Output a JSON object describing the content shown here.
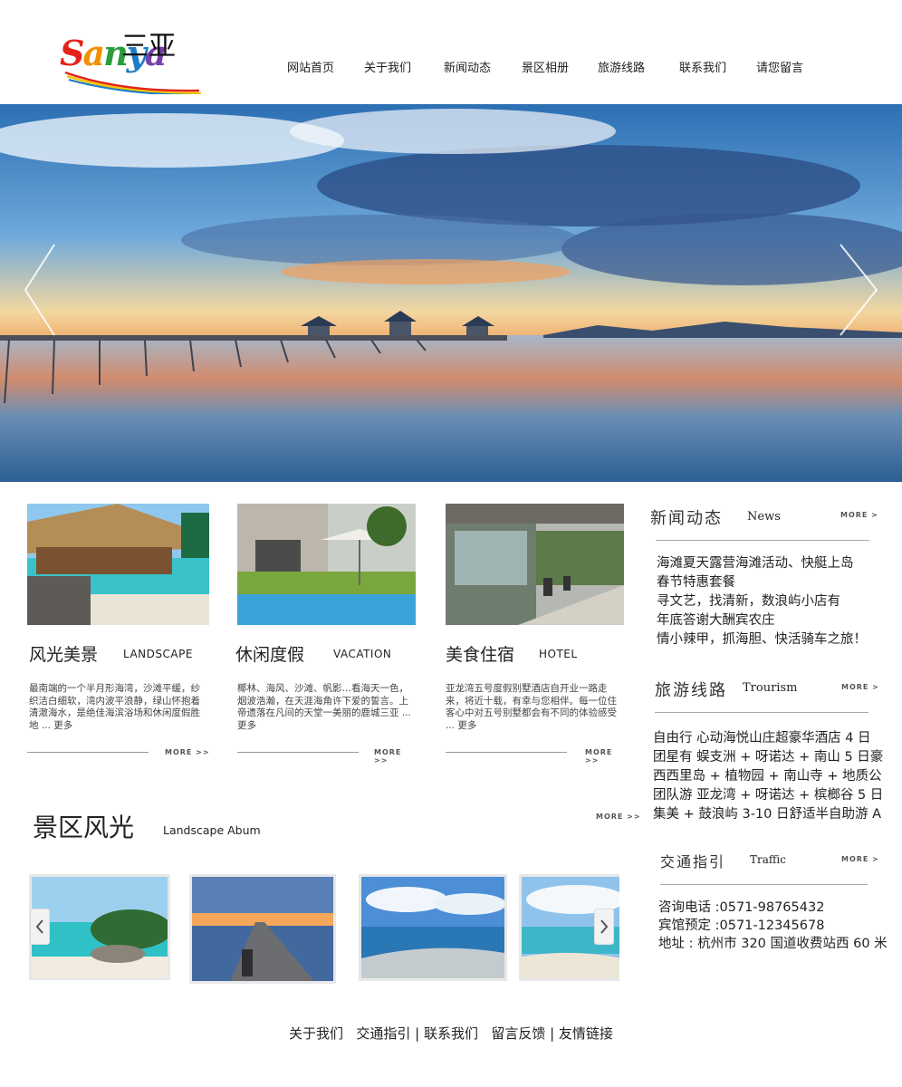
{
  "logo": {
    "latin": [
      "S",
      "a",
      "n",
      "y",
      "a"
    ],
    "hanzi": "三亚"
  },
  "nav": [
    "网站首页",
    "关于我们",
    "新闻动态",
    "景区相册",
    "旅游线路",
    "联系我们",
    "请您留言"
  ],
  "features": [
    {
      "title_cn": "风光美景",
      "title_en": "LANDSCAPE",
      "desc": "最南端的一个半月形海湾，沙滩平缓，纱织洁白细软，湾内波平浪静，绿山怀抱着清澈海水，是绝佳海滨浴场和休闲度假胜地 ... 更多",
      "more": "MORE >>"
    },
    {
      "title_cn": "休闲度假",
      "title_en": "VACATION",
      "desc": "椰林、海风、沙滩、帆影…看海天一色，烟波浩瀚，在天涯海角许下爱的誓言。上帝遗落在凡间的天堂一美丽的鹿城三亚 ... 更多",
      "more": "MORE >>"
    },
    {
      "title_cn": "美食住宿",
      "title_en": "HOTEL",
      "desc": "亚龙湾五号度假别墅酒店自开业一路走来，将近十载，有幸与您相伴。每一位住客心中对五号别墅都会有不同的体验感受 ... 更多",
      "more": "MORE >>"
    }
  ],
  "news": {
    "title_cn": "新闻动态",
    "title_en": "News",
    "more": "MORE >",
    "items": [
      "海滩夏天露营海滩活动、快艇上岛",
      "春节特惠套餐",
      "寻文艺，找清新，数浪屿小店有",
      "年底答谢大酬宾农庄",
      "情小辣甲，抓海胆、快活骑车之旅！"
    ]
  },
  "routes": {
    "title_cn": "旅游线路",
    "title_en": "Trourism",
    "more": "MORE >",
    "items": [
      "自由行 心动海悦山庄超豪华酒店 4 日",
      "团星有 蜈支洲 + 呀诺达 + 南山 5 日豪",
      "西西里岛 + 植物园 + 南山寺 + 地质公",
      "团队游 亚龙湾 + 呀诺达 + 槟榔谷 5 日",
      "集美 + 鼓浪屿 3-10 日舒适半自助游 A"
    ]
  },
  "traffic": {
    "title_cn": "交通指引",
    "title_en": "Traffic",
    "more": "MORE >",
    "items": [
      "咨询电话 :0571-98765432",
      "宾馆预定 :0571-12345678",
      "地址 : 杭州市 320 国道收费站西 60 米"
    ]
  },
  "album": {
    "title": "景区风光",
    "subtitle": "Landscape Abum",
    "more": "MORE >>"
  },
  "footer": [
    "关于我们",
    "交通指引",
    "联系我们",
    "留言反馈",
    "友情链接"
  ],
  "icons": {
    "prev": "chevron-left-icon",
    "next": "chevron-right-icon"
  }
}
